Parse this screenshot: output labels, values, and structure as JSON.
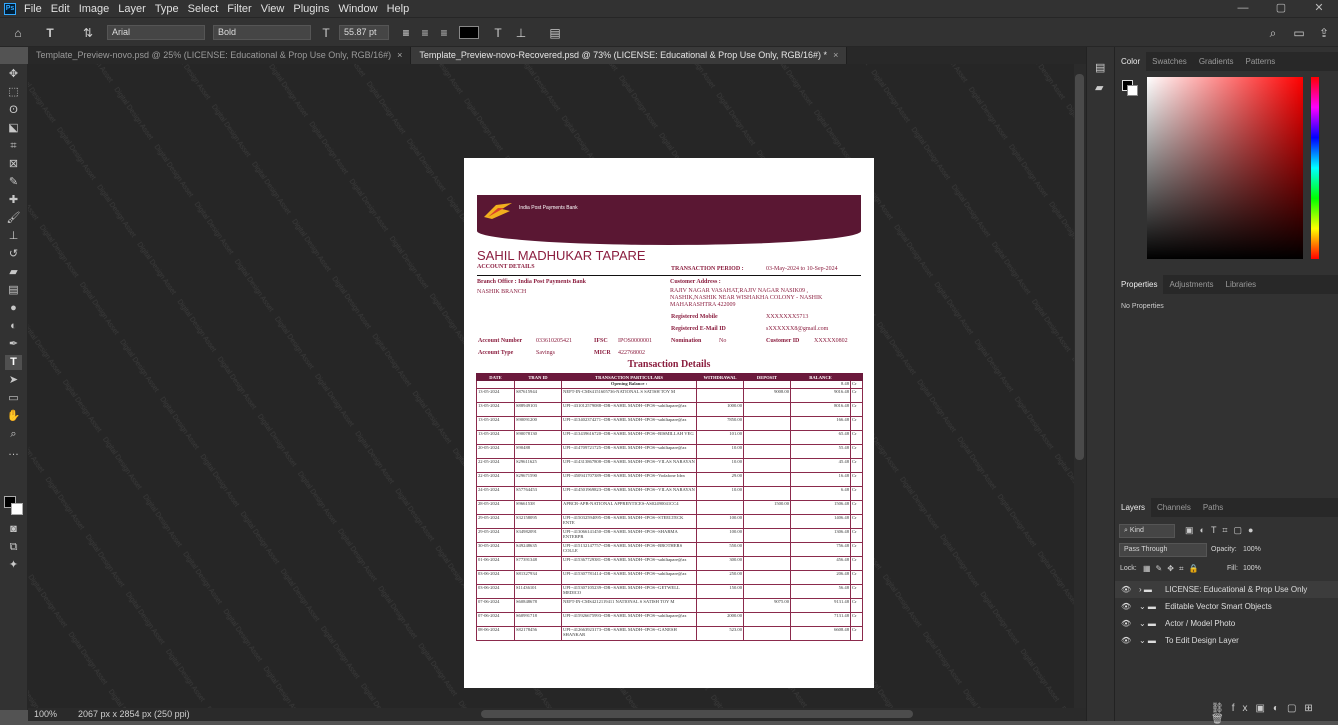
{
  "menu": {
    "items": [
      "File",
      "Edit",
      "Image",
      "Layer",
      "Type",
      "Select",
      "Filter",
      "View",
      "Plugins",
      "Window",
      "Help"
    ],
    "window_controls": [
      "—",
      "▢",
      "✕"
    ]
  },
  "options": {
    "font_family": "Arial",
    "font_style": "Bold",
    "font_size": "55.87 pt"
  },
  "tabs": [
    {
      "label": "Template_Preview-novo.psd @ 25% (LICENSE: Educational & Prop Use Only, RGB/16#)",
      "close": "×"
    },
    {
      "label": "Template_Preview-novo-Recovered.psd @ 73% (LICENSE: Educational & Prop Use Only, RGB/16#) *",
      "close": "×"
    }
  ],
  "status": {
    "zoom": "100%",
    "doc_info": "2067 px x 2854 px (250 ppi)"
  },
  "color_panel": {
    "tabs": [
      "Color",
      "Swatches",
      "Gradients",
      "Patterns"
    ],
    "hue": "#ff0000"
  },
  "properties_panel": {
    "tabs": [
      "Properties",
      "Adjustments",
      "Libraries"
    ],
    "body": "No Properties"
  },
  "layers_panel": {
    "tabs": [
      "Layers",
      "Channels",
      "Paths"
    ],
    "kind": "Kind",
    "blend": "Pass Through",
    "opacity_label": "Opacity:",
    "opacity": "100%",
    "lock_label": "Lock:",
    "fill_label": "Fill:",
    "fill": "100%",
    "layers": [
      "LICENSE: Educational & Prop Use Only",
      "Editable Vector Smart Objects",
      "Actor / Model Photo",
      "To Edit Design Layer"
    ]
  },
  "watermark": "Digital Design Asset",
  "document": {
    "logo_text": "India Post Payments Bank",
    "name": "SAHIL MADHUKAR TAPARE",
    "account_details_label": "ACCOUNT DETAILS",
    "period_label": "TRANSACTION PERIOD :",
    "period": "03-May-2024 to 10-Sep-2024",
    "branch_office": "Branch Office : India Post Payments Bank",
    "branch": "NASHIK BRANCH",
    "customer_address_label": "Customer Address :",
    "customer_address": "RAJIV NAGAR VASAHAT,RAJIV NAGAR NASIK09 , NASHIK,NASHIK NEAR WISHAKHA COLONY - NASHIK MAHARASHTRA 422009",
    "registered_mobile_label": "Registered Mobile",
    "registered_mobile": "XXXXXXX5713",
    "registered_email_label": "Registered E-Mail ID",
    "registered_email": "sXXXXXX8@gmail.com",
    "account_number_label": "Account Number",
    "account_number": "033610205421",
    "ifsc_label": "IFSC",
    "ifsc": "IPOS0000001",
    "nomination_label": "Nomination",
    "nomination": "No",
    "customer_id_label": "Customer ID",
    "customer_id": "XXXXX0802",
    "account_type_label": "Account Type",
    "account_type": "Savings",
    "micr_label": "MICR",
    "micr": "422768002",
    "section_title": "Transaction Details",
    "columns": [
      "DATE",
      "TRAN ID",
      "TRANSACTION PARTICULARS",
      "WITHDRAWAL",
      "DEPOSIT",
      "BALANCE",
      ""
    ],
    "opening_balance_label": "Opening Balance :",
    "opening_balance": "8.48",
    "opening_crdr": "Cr",
    "rows": [
      [
        "13-05-2024",
        "S87615944",
        "NEFT-IN-CMS4151605736-NATIONAL S SATISH TOY M",
        "",
        "9008.00",
        "9016.48",
        "Cr"
      ],
      [
        "13-05-2024",
        "S88949103",
        "UPI--431012579088--DR--SAHIL MADH--IPOS--sahiltapare@ax",
        "1000.00",
        "",
        "8016.48",
        "Cr"
      ],
      [
        "13-05-2024",
        "S90091200",
        "UPI--413402374271--DR--SAHIL MADH--IPOS--sahiltapare@ax",
        "7850.00",
        "",
        "166.48",
        "Cr"
      ],
      [
        "13-05-2024",
        "S90078130",
        "UPI--413439616720--DR--SAHIL MADH--IPOS--BISMILLAH VEG",
        "101.00",
        "",
        "65.48",
        "Cr"
      ],
      [
        "20-05-2024",
        "S90488",
        "UPI--414709721725--DR--SAHIL MADH--IPOS--sahiltapare@ax",
        "10.00",
        "",
        "55.48",
        "Cr"
      ],
      [
        "22-05-2024",
        "S29611625",
        "UPI--414313867808--DR--SAHIL MADH--IPOS--VILAS NARAYAN",
        "10.00",
        "",
        "45.48",
        "Cr"
      ],
      [
        "22-05-2024",
        "S29671590",
        "UPI--450941707389--DR--SAHIL MADH--IPOS--Vodafone Idea",
        "29.00",
        "",
        "16.48",
        "Cr"
      ],
      [
        "24-05-2024",
        "S57764453",
        "UPI--414501969823--DR--SAHIL MADH--IPOS--VILAS NARAYAN",
        "10.00",
        "",
        "6.48",
        "Cr"
      ],
      [
        "28-05-2024",
        "S9661538",
        "APBCR-APB-NATIONAL APPRENTICES-AS02490041CC4",
        "",
        "1500.00",
        "1506.48",
        "Cr"
      ],
      [
        "29-05-2024",
        "S32158095",
        "UPI--415032594095--DR--SAHIL MADH--IPOS--STEELTECK ENTE",
        "100.00",
        "",
        "1406.48",
        "Cr"
      ],
      [
        "29-05-2024",
        "S34982091",
        "UPI--413066141450--DR--SAHIL MADH--IPOS--SHARMA ENTERPR",
        "100.00",
        "",
        "1306.48",
        "Cr"
      ],
      [
        "30-05-2024",
        "S49248635",
        "UPI--415132147757--DR--SAHIL MADH--IPOS--BROTHERS COLLE",
        "550.00",
        "",
        "756.48",
        "Cr"
      ],
      [
        "01-06-2024",
        "S77391348",
        "UPI--415367729381--DR--SAHIL MADH--IPOS--sahiltapare@ax",
        "300.00",
        "",
        "456.48",
        "Cr"
      ],
      [
        "03-06-2024",
        "S81327934",
        "UPI--415307781414--DR--SAHIL MADH--IPOS--sahiltapare@ax",
        "250.00",
        "",
        "206.48",
        "Cr"
      ],
      [
        "03-06-2024",
        "S11436101",
        "UPI--415307105239--DR--SAHIL MADH--IPOS--GETWELL MEDICO",
        "150.00",
        "",
        "56.48",
        "Cr"
      ],
      [
        "07-06-2024",
        "S60848678",
        "NEFT-IN-CMS4212119411 NATIONAL S SATISH TOY M",
        "",
        "9075.00",
        "9131.48",
        "Cr"
      ],
      [
        "07-06-2024",
        "S60991718",
        "UPI--415926675993--DR--SAHIL MADH--IPOS--sahiltapare@ax",
        "2000.00",
        "",
        "7131.48",
        "Cr"
      ],
      [
        "08-06-2024",
        "S82178456",
        "UPI--412663923173--DR--SAHIL MADH--IPOS--GANESH SHANKAR",
        "523.00",
        "",
        "6608.48",
        "Cr"
      ]
    ]
  }
}
